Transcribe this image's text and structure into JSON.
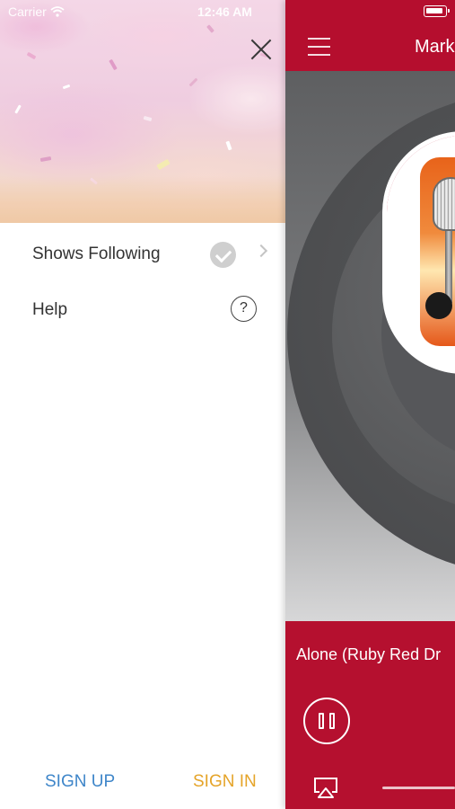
{
  "status_bar": {
    "carrier": "Carrier",
    "time": "12:46 AM"
  },
  "drawer": {
    "menu": [
      {
        "label": "Shows Following",
        "icon": "check-circle-icon",
        "trailing": "chevron-right-icon"
      },
      {
        "label": "Help",
        "icon": "question-circle-icon"
      }
    ],
    "sign_up": "SIGN UP",
    "sign_in": "SIGN IN",
    "colors": {
      "sign_up": "#3f86c9",
      "sign_in": "#e5a429"
    }
  },
  "main": {
    "title": "Mark",
    "now_playing": "Alone (Ruby Red Dr",
    "colors": {
      "accent": "#b5102f"
    }
  }
}
